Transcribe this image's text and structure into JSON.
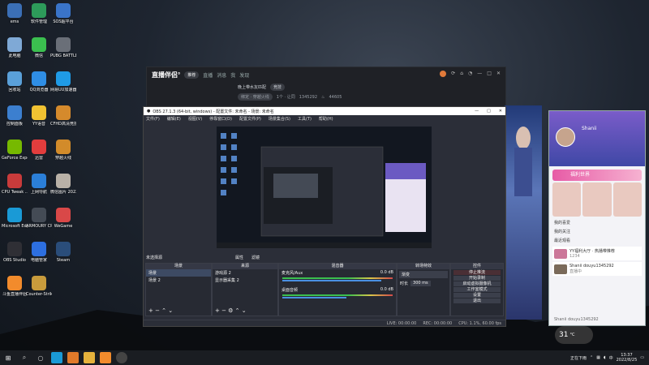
{
  "desktop_icons": [
    {
      "label": "ems",
      "color": "#3b6fb6"
    },
    {
      "label": "软件管理",
      "color": "#2d9b5a"
    },
    {
      "label": "SOS超平台",
      "color": "#3a74c9"
    },
    {
      "label": "此电脑",
      "color": "#7fa9d6"
    },
    {
      "label": "微信",
      "color": "#3bbf4f"
    },
    {
      "label": "PUBG BATTLEGR...",
      "color": "#6a6f78"
    },
    {
      "label": "回收站",
      "color": "#5aa0d9"
    },
    {
      "label": "QQ浏览器",
      "color": "#2f8ee5"
    },
    {
      "label": "网易UU加速器",
      "color": "#1f9be6"
    },
    {
      "label": "控制面板",
      "color": "#3c7fcf"
    },
    {
      "label": "YY语音",
      "color": "#f1c232"
    },
    {
      "label": "CFHD高清竞技大区",
      "color": "#d58a2c"
    },
    {
      "label": "GeForce Experience",
      "color": "#76b900"
    },
    {
      "label": "迅雷",
      "color": "#e23d3d"
    },
    {
      "label": "穿越火线",
      "color": "#d28b2a"
    },
    {
      "label": "CPU Tweak ...",
      "color": "#c93b3b"
    },
    {
      "label": "上网导航",
      "color": "#2b7fd8"
    },
    {
      "label": "微信图片 2022062...",
      "color": "#b9b1a7"
    },
    {
      "label": "Microsoft Edge",
      "color": "#1a9ad6"
    },
    {
      "label": "ARMOURY CRATE",
      "color": "#444b55"
    },
    {
      "label": "WeGame",
      "color": "#d94848"
    },
    {
      "label": "OBS Studio",
      "color": "#2f2f35"
    },
    {
      "label": "电脑管家",
      "color": "#2d6fe0"
    },
    {
      "label": "Steam",
      "color": "#2a4d7a"
    },
    {
      "label": "斗鱼直播伴侣",
      "color": "#f28b2c"
    },
    {
      "label": "Counter-Strike Global Off...",
      "color": "#c89b3c"
    }
  ],
  "zbw": {
    "logo": "直播伴侣°",
    "tag": "推荐",
    "nav": [
      "直播",
      "消息",
      "我",
      "发现"
    ],
    "room_title": "晚上带水友匹配",
    "room_tag": "竞技",
    "row3_a": "绑定 · 穿越火线",
    "row3_b": "1个 · 让同",
    "row3_id": "1345292",
    "row3_count": "44605"
  },
  "obs": {
    "title": "OBS 27.1.3 (64-bit, windows) - 配置文件: 未命名 - 场景: 未命名",
    "menu": [
      "文件(F)",
      "编辑(E)",
      "视图(V)",
      "停靠窗口(D)",
      "配置文件(P)",
      "场景集合(S)",
      "工具(T)",
      "帮助(H)"
    ],
    "scene_bar": [
      "未选择源",
      "属性",
      "滤镜"
    ],
    "docks": {
      "scenes": {
        "title": "场景",
        "items": [
          "场景",
          "场景 2"
        ]
      },
      "sources": {
        "title": "来源",
        "items": [
          "游戏源 2",
          "显示器采集 2"
        ]
      },
      "mixer": {
        "title": "混音器",
        "ch1": "麦克风/Aux",
        "ch2": "桌面音频",
        "db1": "0.0 dB",
        "db2": "0.0 dB"
      },
      "transitions": {
        "title": "转场特效",
        "type": "渐变",
        "duration_label": "时长",
        "duration": "300 ms"
      },
      "controls": {
        "title": "控件",
        "buttons": [
          "停止推流",
          "开始录制",
          "启动虚拟摄像机",
          "工作室模式",
          "设置",
          "退出"
        ]
      }
    },
    "status": [
      "LIVE: 00:00:00",
      "REC: 00:00:00",
      "CPU: 1.1%, 60.00 fps"
    ]
  },
  "side": {
    "name": "Shanii",
    "banner": "福利世界",
    "links": [
      "我的喜爱",
      "我的关注",
      "最近观看"
    ],
    "cards": [
      {
        "text": "YY福利大厅 · 热播带推荐",
        "sub": "1234"
      },
      {
        "text": "Shanii douyu1345292",
        "sub": "直播中"
      }
    ],
    "footer": "Shanii douyu1345292"
  },
  "weather": {
    "temp": "31",
    "unit": "°C"
  },
  "taskbar": {
    "apps": [
      "start",
      "search",
      "cortana",
      "edge",
      "sogou",
      "explorer",
      "douyu",
      "obs"
    ],
    "tray_text": "正在下雨",
    "ime": "中",
    "time": "13:37",
    "date": "2022/8/25"
  }
}
